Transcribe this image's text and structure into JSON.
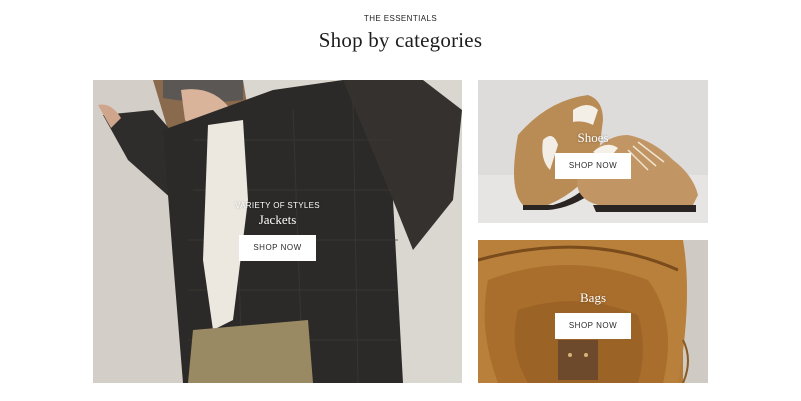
{
  "section": {
    "eyebrow": "THE ESSENTIALS",
    "title": "Shop by categories"
  },
  "categories": [
    {
      "kicker": "VARIETY OF STYLES",
      "title": "Jackets",
      "cta": "SHOP NOW",
      "image": "model-in-dark-quilted-jacket"
    },
    {
      "title": "Shoes",
      "cta": "SHOP NOW",
      "image": "tan-suede-sneakers"
    },
    {
      "title": "Bags",
      "cta": "SHOP NOW",
      "image": "tan-leather-bag-interior"
    }
  ],
  "colors": {
    "button_bg": "#ffffff",
    "overlay_text": "#ffffff",
    "heading": "#1d1d1d"
  }
}
